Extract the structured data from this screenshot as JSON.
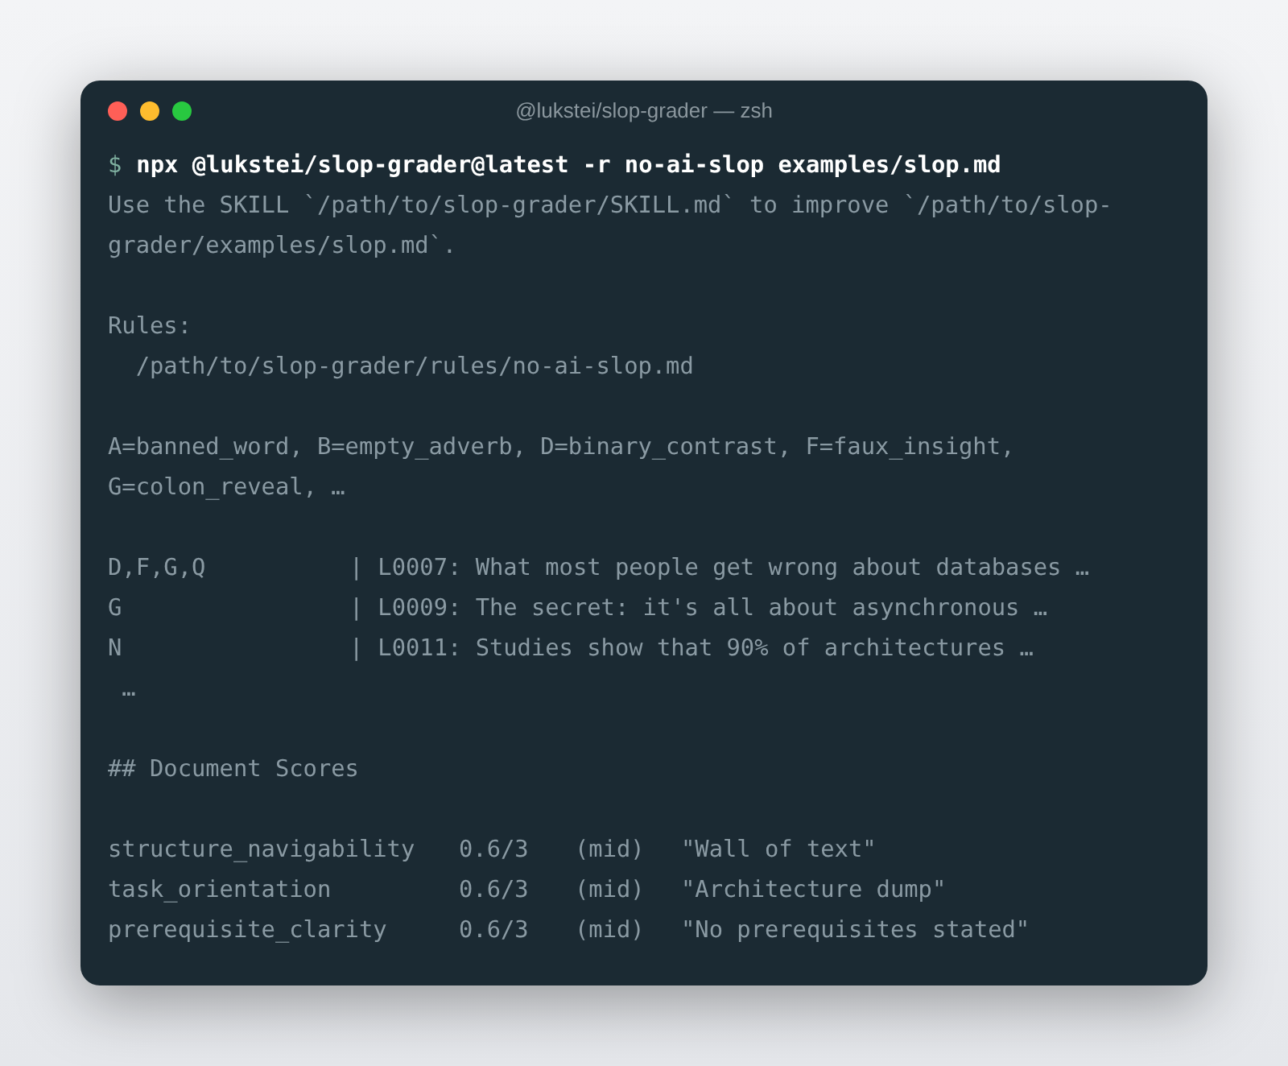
{
  "window": {
    "title": "@lukstei/slop-grader — zsh"
  },
  "prompt": {
    "symbol": "$",
    "command": "npx @lukstei/slop-grader@latest -r no-ai-slop examples/slop.md"
  },
  "output": [
    {
      "kind": "text",
      "text": "Use the SKILL `/path/to/slop-grader/SKILL.md` to improve `/path/to/slop-grader/examples/slop.md`."
    },
    {
      "kind": "blank"
    },
    {
      "kind": "text",
      "text": "Rules:"
    },
    {
      "kind": "text",
      "text": "  /path/to/slop-grader/rules/no-ai-slop.md"
    },
    {
      "kind": "blank"
    },
    {
      "kind": "text",
      "text": "A=banned_word, B=empty_adverb, D=binary_contrast, F=faux_insight, G=colon_reveal, …"
    },
    {
      "kind": "blank"
    },
    {
      "kind": "finding",
      "codes": "D,F,G,Q",
      "separator": "|",
      "line": "L0007: What most people get wrong about databases …"
    },
    {
      "kind": "finding",
      "codes": "G",
      "separator": "|",
      "line": "L0009: The secret: it's all about asynchronous …"
    },
    {
      "kind": "finding",
      "codes": "N",
      "separator": "|",
      "line": "L0011: Studies show that 90% of architectures …"
    },
    {
      "kind": "text",
      "text": " …"
    },
    {
      "kind": "blank"
    },
    {
      "kind": "text",
      "text": "## Document Scores"
    },
    {
      "kind": "blank"
    },
    {
      "kind": "score",
      "name": "structure_navigability",
      "score": "0.6/3",
      "band": "(mid)",
      "note": "\"Wall of text\""
    },
    {
      "kind": "score",
      "name": "task_orientation",
      "score": "0.6/3",
      "band": "(mid)",
      "note": "\"Architecture dump\""
    },
    {
      "kind": "score",
      "name": "prerequisite_clarity",
      "score": "0.6/3",
      "band": "(mid)",
      "note": "\"No prerequisites stated\""
    }
  ]
}
